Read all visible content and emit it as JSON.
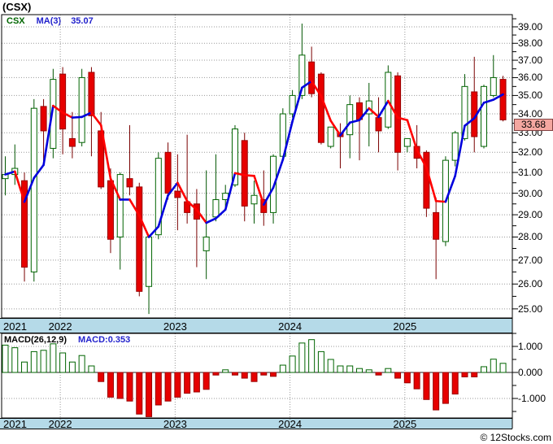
{
  "header": {
    "title": "(CSX)"
  },
  "legend": {
    "symbol": "CSX",
    "ma_label": "MA(3)",
    "ma_value": "35.07"
  },
  "price_badge": "33.68",
  "macd_panel": {
    "label": "MACD(26,12,9)",
    "value_label": "MACD:0.353"
  },
  "footer": {
    "copyright": "© 12Stocks.com"
  },
  "chart_data": {
    "type": "candlestick+macd-histogram",
    "symbol": "CSX",
    "title": "(CSX)",
    "ma_period": 3,
    "ma_last_value": 35.07,
    "macd_params": "26,12,9",
    "macd_last_value": 0.353,
    "last_price": 33.68,
    "price_axis": {
      "scale": "log",
      "min": 24.6,
      "max": 39.6,
      "ticks": [
        39,
        38,
        37,
        36,
        35,
        34,
        33,
        32,
        31,
        30,
        29,
        28,
        27,
        26,
        25
      ],
      "tick_labels": [
        "39.00",
        "38.00",
        "37.00",
        "36.00",
        "35.00",
        "34.00",
        "33.00",
        "32.00",
        "31.00",
        "30.00",
        "29.00",
        "28.00",
        "27.00",
        "26.00",
        "25.00"
      ]
    },
    "macd_axis": {
      "ticks": [
        1,
        0,
        -1
      ],
      "tick_labels": [
        "1.000",
        "0.000",
        "-1.000"
      ],
      "range": [
        -1.75,
        1.45
      ]
    },
    "x_axis": {
      "years": [
        "2021",
        "2022",
        "2023",
        "2024",
        "2025"
      ],
      "grid": "dotted"
    },
    "months": [
      "2021-07",
      "2021-08",
      "2021-09",
      "2021-10",
      "2021-11",
      "2021-12",
      "2022-01",
      "2022-02",
      "2022-03",
      "2022-04",
      "2022-05",
      "2022-06",
      "2022-07",
      "2022-08",
      "2022-09",
      "2022-10",
      "2022-11",
      "2022-12",
      "2023-01",
      "2023-02",
      "2023-03",
      "2023-04",
      "2023-05",
      "2023-06",
      "2023-07",
      "2023-08",
      "2023-09",
      "2023-10",
      "2023-11",
      "2023-12",
      "2024-01",
      "2024-02",
      "2024-03",
      "2024-04",
      "2024-05",
      "2024-06",
      "2024-07",
      "2024-08",
      "2024-09",
      "2024-10",
      "2024-11",
      "2024-12",
      "2025-01",
      "2025-02",
      "2025-03",
      "2025-04",
      "2025-05",
      "2025-06",
      "2025-07",
      "2025-08",
      "2025-09",
      "2025-10",
      "2025-11"
    ],
    "ohlc": [
      [
        30.7,
        31.8,
        29.9,
        30.9
      ],
      [
        30.9,
        32.4,
        30.4,
        31.2
      ],
      [
        30.6,
        31.0,
        26.1,
        26.7
      ],
      [
        26.5,
        34.8,
        26.1,
        34.3
      ],
      [
        34.4,
        34.8,
        31.5,
        33.1
      ],
      [
        32.2,
        36.5,
        31.7,
        35.9
      ],
      [
        36.2,
        36.6,
        31.9,
        33.2
      ],
      [
        32.7,
        34.1,
        31.7,
        32.3
      ],
      [
        32.5,
        36.5,
        32.3,
        36.0
      ],
      [
        36.3,
        36.6,
        31.8,
        33.9
      ],
      [
        33.1,
        34.1,
        30.2,
        30.3
      ],
      [
        30.6,
        31.2,
        27.3,
        27.9
      ],
      [
        28.0,
        31.0,
        26.6,
        30.9
      ],
      [
        30.7,
        33.4,
        29.9,
        30.3
      ],
      [
        30.3,
        30.5,
        25.5,
        25.7
      ],
      [
        25.9,
        28.1,
        24.8,
        28.0
      ],
      [
        28.1,
        32.0,
        27.9,
        31.7
      ],
      [
        32.0,
        32.5,
        29.7,
        30.0
      ],
      [
        30.1,
        31.9,
        28.3,
        29.8
      ],
      [
        29.6,
        32.9,
        28.6,
        29.1
      ],
      [
        29.5,
        30.2,
        26.7,
        28.8
      ],
      [
        27.4,
        31.1,
        26.2,
        28.0
      ],
      [
        28.9,
        31.9,
        28.7,
        29.7
      ],
      [
        29.7,
        30.4,
        29.3,
        30.0
      ],
      [
        30.4,
        33.4,
        30.3,
        33.2
      ],
      [
        32.6,
        33.0,
        28.7,
        29.4
      ],
      [
        29.5,
        30.6,
        28.6,
        29.9
      ],
      [
        29.7,
        31.1,
        28.5,
        29.1
      ],
      [
        29.1,
        31.9,
        28.6,
        31.8
      ],
      [
        31.8,
        34.3,
        31.7,
        34.0
      ],
      [
        34.0,
        35.3,
        33.8,
        35.0
      ],
      [
        35.0,
        39.2,
        34.8,
        37.3
      ],
      [
        36.9,
        37.8,
        34.9,
        35.1
      ],
      [
        36.2,
        36.3,
        32.4,
        32.5
      ],
      [
        32.3,
        33.3,
        32.2,
        33.3
      ],
      [
        33.0,
        33.5,
        31.2,
        32.8
      ],
      [
        32.9,
        35.0,
        31.7,
        34.5
      ],
      [
        34.6,
        34.9,
        31.6,
        33.7
      ],
      [
        34.0,
        35.7,
        32.3,
        34.7
      ],
      [
        33.8,
        34.9,
        32.0,
        33.1
      ],
      [
        33.3,
        36.7,
        33.2,
        36.3
      ],
      [
        36.1,
        36.3,
        31.1,
        32.0
      ],
      [
        32.3,
        32.7,
        32.0,
        32.7
      ],
      [
        32.3,
        33.4,
        31.2,
        31.7
      ],
      [
        32.0,
        32.1,
        28.9,
        29.3
      ],
      [
        29.1,
        29.8,
        26.2,
        27.9
      ],
      [
        27.8,
        31.8,
        27.6,
        31.6
      ],
      [
        31.6,
        33.1,
        31.3,
        33.0
      ],
      [
        32.7,
        36.2,
        32.6,
        35.5
      ],
      [
        35.2,
        37.2,
        32.0,
        32.8
      ],
      [
        32.3,
        35.6,
        32.2,
        35.5
      ],
      [
        35.0,
        37.3,
        34.9,
        36.0
      ],
      [
        35.9,
        36.1,
        33.6,
        33.68
      ]
    ],
    "macd_hist": [
      1.05,
      0.95,
      0.4,
      0.8,
      0.85,
      1.1,
      0.75,
      0.4,
      0.65,
      0.25,
      -0.35,
      -0.95,
      -1.0,
      -1.1,
      -1.6,
      -1.7,
      -1.25,
      -1.1,
      -0.95,
      -0.8,
      -0.75,
      -0.65,
      -0.1,
      0.1,
      -0.1,
      -0.22,
      -0.35,
      -0.1,
      -0.15,
      0.28,
      0.63,
      1.13,
      1.26,
      0.8,
      0.5,
      0.25,
      0.25,
      0.15,
      0.1,
      -0.1,
      0.15,
      -0.22,
      -0.4,
      -0.63,
      -1.04,
      -1.44,
      -1.19,
      -0.83,
      -0.17,
      -0.17,
      0.22,
      0.51,
      0.35
    ],
    "colors": {
      "up_fill": "#ffffff",
      "up_border": "#006400",
      "down_fill": "#e60000",
      "down_border": "#990000",
      "wick_up": "#005500",
      "wick_down": "#7a0000",
      "ma_up": "#0000dd",
      "ma_down": "#ff0000",
      "grid": "#999999",
      "band": "#b5dae8",
      "badge_bg": "#f4a7a0",
      "badge_border": "#804040",
      "legend_green": "#006600",
      "legend_blue": "#2222cc"
    },
    "layout_hint": {
      "grid": true,
      "legend_position": "top-left",
      "price_labels": "right"
    }
  }
}
